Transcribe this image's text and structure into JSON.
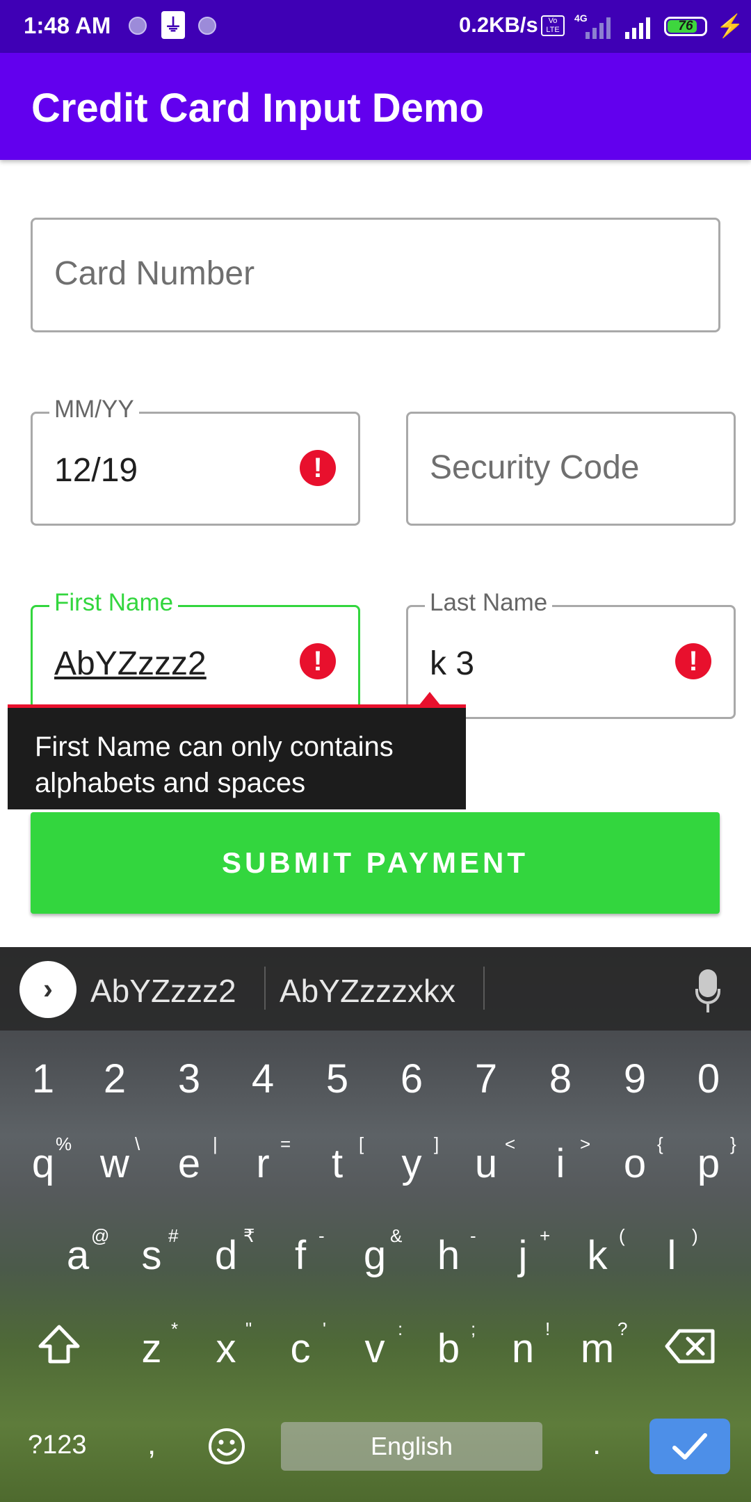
{
  "status_bar": {
    "time": "1:48 AM",
    "net_speed": "0.2KB/s",
    "volte": "Vo LTE",
    "network": "4G",
    "battery": "76"
  },
  "app_bar": {
    "title": "Credit Card Input Demo"
  },
  "form": {
    "card_number": {
      "placeholder": "Card Number"
    },
    "expiry": {
      "label": "MM/YY",
      "value": "12/19"
    },
    "security_code": {
      "placeholder": "Security Code"
    },
    "first_name": {
      "label": "First Name",
      "value": "AbYZzzz2"
    },
    "last_name": {
      "label": "Last Name",
      "value": "k 3"
    },
    "error_tooltip": "First Name can only contains alphabets and spaces",
    "error_tooltip_lines": [
      "First Name can only contains",
      "alphabets and spaces"
    ],
    "submit_label": "SUBMIT PAYMENT"
  },
  "keyboard": {
    "suggestions": [
      "AbYZzzz2",
      "AbYZzzzxkx"
    ],
    "number_row": [
      "1",
      "2",
      "3",
      "4",
      "5",
      "6",
      "7",
      "8",
      "9",
      "0"
    ],
    "row1": [
      {
        "key": "q",
        "alt": "%"
      },
      {
        "key": "w",
        "alt": "\\"
      },
      {
        "key": "e",
        "alt": "|"
      },
      {
        "key": "r",
        "alt": "="
      },
      {
        "key": "t",
        "alt": "["
      },
      {
        "key": "y",
        "alt": "]"
      },
      {
        "key": "u",
        "alt": "<"
      },
      {
        "key": "i",
        "alt": ">"
      },
      {
        "key": "o",
        "alt": "{"
      },
      {
        "key": "p",
        "alt": "}"
      }
    ],
    "row2": [
      {
        "key": "a",
        "alt": "@"
      },
      {
        "key": "s",
        "alt": "#"
      },
      {
        "key": "d",
        "alt": "₹"
      },
      {
        "key": "f",
        "alt": "-"
      },
      {
        "key": "g",
        "alt": "&"
      },
      {
        "key": "h",
        "alt": "-"
      },
      {
        "key": "j",
        "alt": "+"
      },
      {
        "key": "k",
        "alt": "("
      },
      {
        "key": "l",
        "alt": ")"
      }
    ],
    "row3": [
      {
        "key": "z",
        "alt": "*"
      },
      {
        "key": "x",
        "alt": "\""
      },
      {
        "key": "c",
        "alt": "'"
      },
      {
        "key": "v",
        "alt": ":"
      },
      {
        "key": "b",
        "alt": ";"
      },
      {
        "key": "n",
        "alt": "!"
      },
      {
        "key": "m",
        "alt": "?"
      }
    ],
    "symbols_key": "?123",
    "comma_key": ",",
    "space_label": "English",
    "period_key": "."
  },
  "colors": {
    "app_bar": "#6200ee",
    "status_bar": "#3f00b5",
    "accent_green": "#33d63e",
    "error_red": "#e8102d",
    "enter_key": "#4d8fe8"
  }
}
